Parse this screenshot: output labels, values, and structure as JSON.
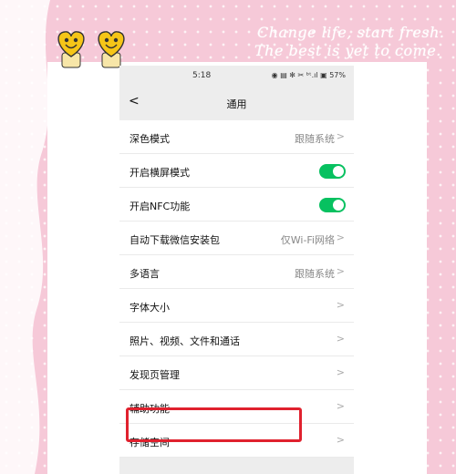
{
  "status_bar": {
    "time": "5:18",
    "icons_text": "◉ ▤ ✻ ✂ ᵇᵗ.ıl ▣ 57%"
  },
  "nav": {
    "back": "<",
    "title": "通用"
  },
  "banner": {
    "line1": "Change life, start fresh.",
    "line2": "The best is yet to come."
  },
  "rows": [
    {
      "label": "深色模式",
      "value": "跟随系统",
      "control": "chevron"
    },
    {
      "label": "开启横屏模式",
      "value": "",
      "control": "toggle-on"
    },
    {
      "label": "开启NFC功能",
      "value": "",
      "control": "toggle-on"
    },
    {
      "label": "自动下载微信安装包",
      "value": "仅Wi-Fi网络",
      "control": "chevron"
    },
    {
      "label": "多语言",
      "value": "跟随系统",
      "control": "chevron"
    },
    {
      "label": "字体大小",
      "value": "",
      "control": "chevron"
    },
    {
      "label": "照片、视频、文件和通话",
      "value": "",
      "control": "chevron"
    },
    {
      "label": "发现页管理",
      "value": "",
      "control": "chevron"
    },
    {
      "label": "辅助功能",
      "value": "",
      "control": "chevron"
    },
    {
      "label": "存储空间",
      "value": "",
      "control": "chevron"
    }
  ],
  "chevron_glyph": ">",
  "colors": {
    "toggle_on": "#07c160",
    "highlight": "#e0212e",
    "background": "#f6c9d8"
  }
}
